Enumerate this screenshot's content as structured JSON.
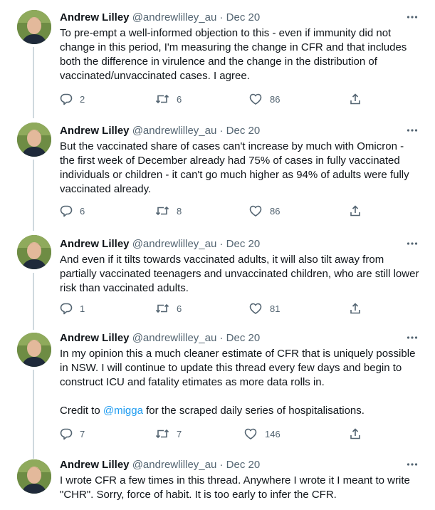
{
  "tweets": [
    {
      "name": "Andrew Lilley",
      "handle": "@andrewlilley_au",
      "date": "Dec 20",
      "separator": "·",
      "text": [
        "To pre-empt a well-informed objection to this - even if immunity did not change in this period, I'm measuring the change in CFR and that includes both the difference in virulence and the change in the distribution of vaccinated/unvaccinated cases. I agree."
      ],
      "replies": "2",
      "retweets": "6",
      "likes": "86"
    },
    {
      "name": "Andrew Lilley",
      "handle": "@andrewlilley_au",
      "date": "Dec 20",
      "separator": "·",
      "text": [
        "But the vaccinated share of cases can't increase by much with Omicron - the first week of December already had 75% of cases in fully vaccinated individuals or children - it can't go much higher as 94% of adults were fully vaccinated already."
      ],
      "replies": "6",
      "retweets": "8",
      "likes": "86"
    },
    {
      "name": "Andrew Lilley",
      "handle": "@andrewlilley_au",
      "date": "Dec 20",
      "separator": "·",
      "text": [
        "And even if it tilts towards vaccinated adults, it will also tilt away from partially vaccinated teenagers and unvaccinated children, who are still lower risk than vaccinated adults."
      ],
      "replies": "1",
      "retweets": "6",
      "likes": "81"
    },
    {
      "name": "Andrew Lilley",
      "handle": "@andrewlilley_au",
      "date": "Dec 20",
      "separator": "·",
      "text": [
        "In my opinion this a much cleaner estimate of CFR that is uniquely possible in NSW. I will continue to update this thread every few days and begin to construct ICU and fatality etimates as more data rolls in."
      ],
      "credit_prefix": "Credit to ",
      "credit_mention": "@migga",
      "credit_suffix": " for the scraped daily series of hospitalisations.",
      "replies": "7",
      "retweets": "7",
      "likes": "146"
    },
    {
      "name": "Andrew Lilley",
      "handle": "@andrewlilley_au",
      "date": "Dec 20",
      "separator": "·",
      "text": [
        "I wrote CFR a few times in this thread. Anywhere I wrote it I meant to write \"CHR\". Sorry, force of habit. It is too early to infer the CFR."
      ]
    }
  ],
  "icons": {
    "more": "more-horizontal-icon",
    "reply": "reply-icon",
    "retweet": "retweet-icon",
    "like": "heart-icon",
    "share": "share-icon"
  },
  "colors": {
    "mention": "#1d9bf0",
    "muted": "#536471",
    "thread_line": "#cfd9de"
  }
}
